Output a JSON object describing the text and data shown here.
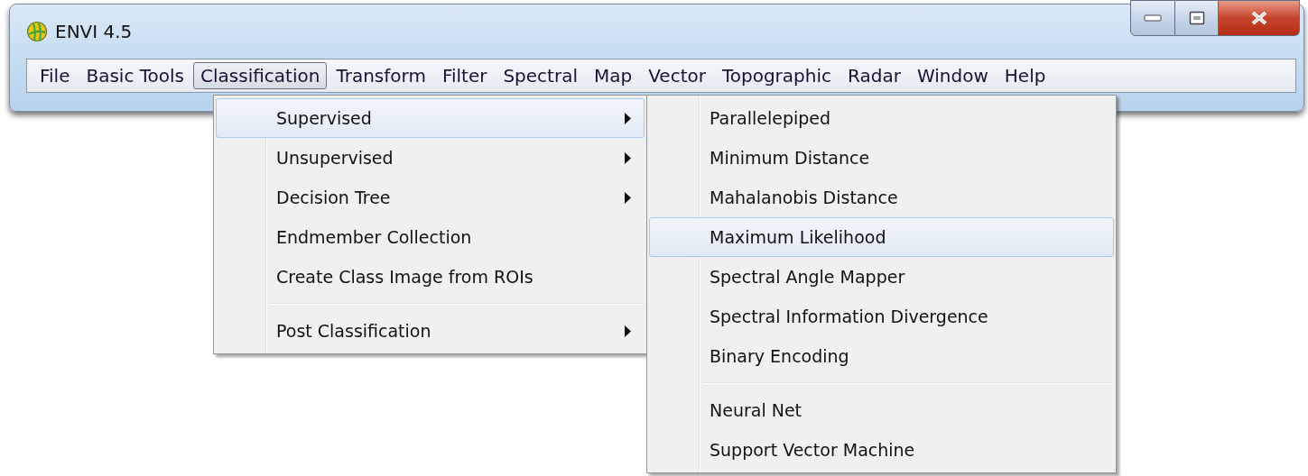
{
  "window": {
    "title": "ENVI 4.5"
  },
  "menubar": [
    {
      "label": "File",
      "selected": false
    },
    {
      "label": "Basic Tools",
      "selected": false
    },
    {
      "label": "Classification",
      "selected": true
    },
    {
      "label": "Transform",
      "selected": false
    },
    {
      "label": "Filter",
      "selected": false
    },
    {
      "label": "Spectral",
      "selected": false
    },
    {
      "label": "Map",
      "selected": false
    },
    {
      "label": "Vector",
      "selected": false
    },
    {
      "label": "Topographic",
      "selected": false
    },
    {
      "label": "Radar",
      "selected": false
    },
    {
      "label": "Window",
      "selected": false
    },
    {
      "label": "Help",
      "selected": false
    }
  ],
  "menu": [
    {
      "kind": "item",
      "label": "Supervised",
      "has_submenu": true,
      "selected": true
    },
    {
      "kind": "item",
      "label": "Unsupervised",
      "has_submenu": true,
      "selected": false
    },
    {
      "kind": "item",
      "label": "Decision Tree",
      "has_submenu": true,
      "selected": false
    },
    {
      "kind": "item",
      "label": "Endmember Collection",
      "has_submenu": false,
      "selected": false
    },
    {
      "kind": "item",
      "label": "Create Class Image from ROIs",
      "has_submenu": false,
      "selected": false
    },
    {
      "kind": "separator"
    },
    {
      "kind": "item",
      "label": "Post Classification",
      "has_submenu": true,
      "selected": false
    }
  ],
  "submenu": [
    {
      "kind": "item",
      "label": "Parallelepiped",
      "selected": false
    },
    {
      "kind": "item",
      "label": "Minimum Distance",
      "selected": false
    },
    {
      "kind": "item",
      "label": "Mahalanobis Distance",
      "selected": false
    },
    {
      "kind": "item",
      "label": "Maximum Likelihood",
      "selected": true
    },
    {
      "kind": "item",
      "label": "Spectral Angle Mapper",
      "selected": false
    },
    {
      "kind": "item",
      "label": "Spectral Information Divergence",
      "selected": false
    },
    {
      "kind": "item",
      "label": "Binary Encoding",
      "selected": false
    },
    {
      "kind": "separator"
    },
    {
      "kind": "item",
      "label": "Neural Net",
      "selected": false
    },
    {
      "kind": "item",
      "label": "Support Vector Machine",
      "selected": false
    }
  ]
}
